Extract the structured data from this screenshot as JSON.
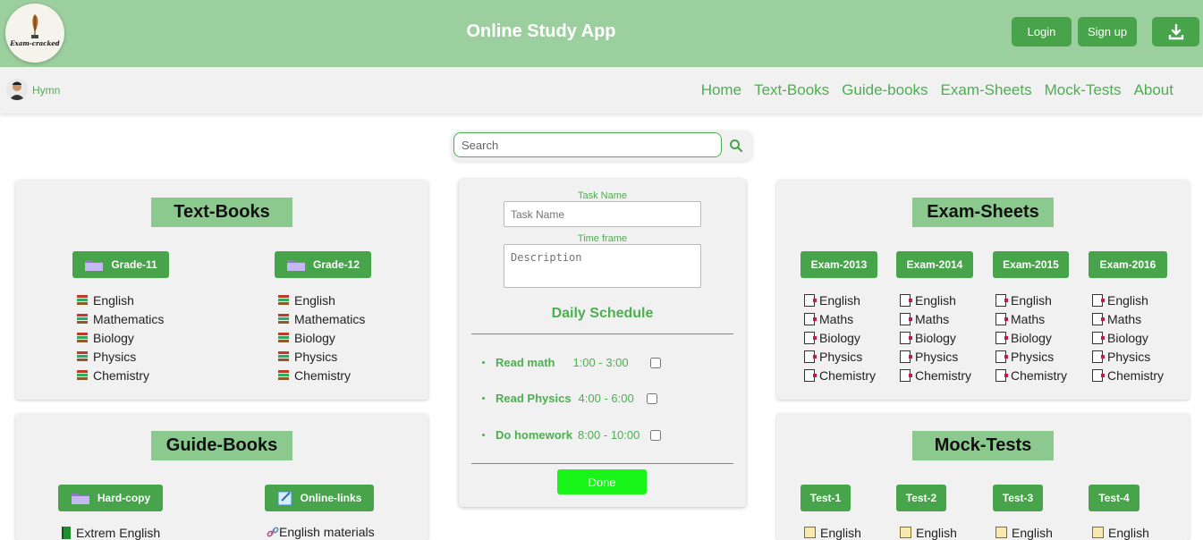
{
  "header": {
    "logo_text": "Exam-cracked",
    "title": "Online Study App",
    "login_label": "Login",
    "signup_label": "Sign up",
    "download_icon": "download-icon"
  },
  "nav": {
    "username": "Hymn",
    "links": [
      "Home",
      "Text-Books",
      "Guide-books",
      "Exam-Sheets",
      "Mock-Tests",
      "About"
    ]
  },
  "search": {
    "placeholder": "Search"
  },
  "textbooks": {
    "title": "Text-Books",
    "grades": [
      {
        "label": "Grade-11",
        "subjects": [
          "English",
          "Mathematics",
          "Biology",
          "Physics",
          "Chemistry"
        ]
      },
      {
        "label": "Grade-12",
        "subjects": [
          "English",
          "Mathematics",
          "Biology",
          "Physics",
          "Chemistry"
        ]
      }
    ]
  },
  "guidebooks": {
    "title": "Guide-Books",
    "hardcopy_label": "Hard-copy",
    "online_label": "Online-links",
    "hardcopy_first": "Extrem English",
    "online_first": "English materials"
  },
  "schedule": {
    "task_name_label": "Task Name",
    "task_name_placeholder": "Task Name",
    "time_frame_label": "Time frame",
    "description_placeholder": "Description",
    "title": "Daily Schedule",
    "tasks": [
      {
        "name": "Read math",
        "time": "1:00 - 3:00"
      },
      {
        "name": "Read Physics",
        "time": "4:00 - 6:00"
      },
      {
        "name": "Do homework",
        "time": "8:00 - 10:00"
      }
    ],
    "done_label": "Done"
  },
  "examsheets": {
    "title": "Exam-Sheets",
    "years": [
      {
        "label": "Exam-2013",
        "subjects": [
          "English",
          "Maths",
          "Biology",
          "Physics",
          "Chemistry"
        ]
      },
      {
        "label": "Exam-2014",
        "subjects": [
          "English",
          "Maths",
          "Biology",
          "Physics",
          "Chemistry"
        ]
      },
      {
        "label": "Exam-2015",
        "subjects": [
          "English",
          "Maths",
          "Biology",
          "Physics",
          "Chemistry"
        ]
      },
      {
        "label": "Exam-2016",
        "subjects": [
          "English",
          "Maths",
          "Biology",
          "Physics",
          "Chemistry"
        ]
      }
    ]
  },
  "mocktests": {
    "title": "Mock-Tests",
    "tests": [
      {
        "label": "Test-1",
        "first": "English"
      },
      {
        "label": "Test-2",
        "first": "English"
      },
      {
        "label": "Test-3",
        "first": "English"
      },
      {
        "label": "Test-4",
        "first": "English"
      }
    ]
  },
  "colors": {
    "header": "#9ccf9e",
    "accent": "#4caf50",
    "button": "#47a44b",
    "title_bg": "#8cc98e",
    "done": "#19f519"
  }
}
